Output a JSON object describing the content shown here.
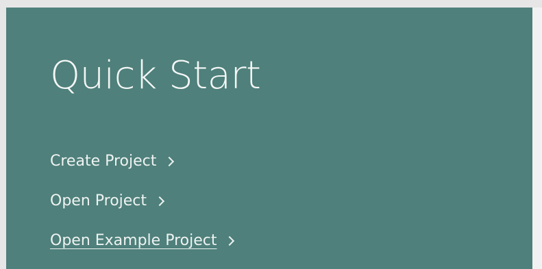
{
  "panel": {
    "title": "Quick Start",
    "background_color": "#4f807b",
    "links": [
      {
        "label": "Create Project",
        "icon": "chevron-right-icon",
        "underlined": false
      },
      {
        "label": "Open Project",
        "icon": "chevron-right-icon",
        "underlined": false
      },
      {
        "label": "Open Example Project",
        "icon": "chevron-right-icon",
        "underlined": true
      }
    ]
  }
}
